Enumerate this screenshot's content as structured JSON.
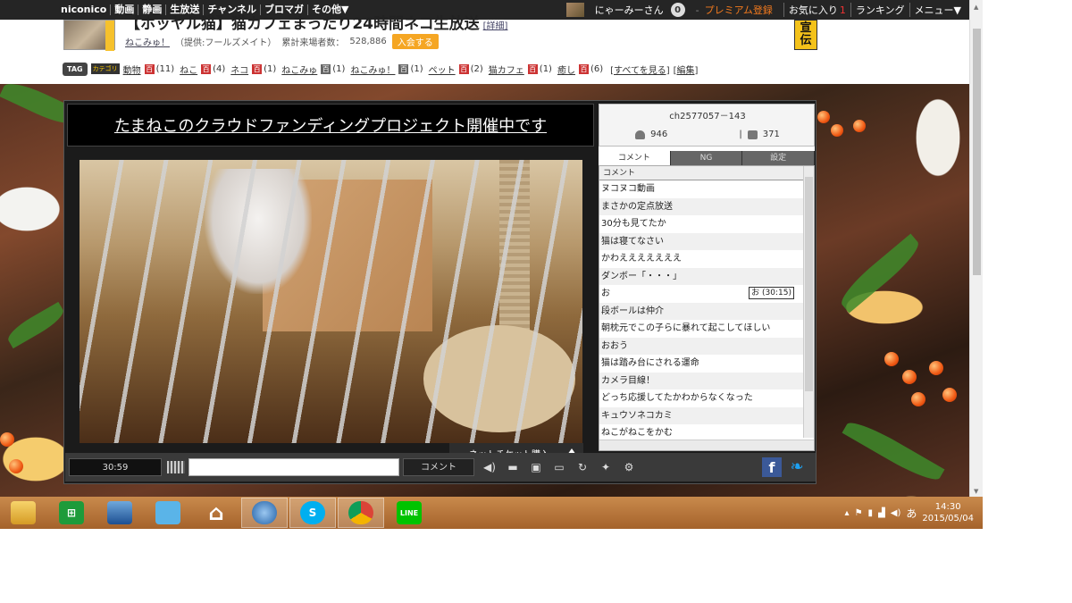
{
  "topnav": {
    "brand": "niconico",
    "links": [
      "動画",
      "静画",
      "生放送",
      "チャンネル",
      "ブロマガ",
      "その他▼"
    ],
    "user": "にゃーみーさん",
    "notif_count": "0",
    "premium": "プレミアム登録",
    "favorites": "お気に入り",
    "favorites_count": "1",
    "ranking": "ランキング",
    "menu": "メニュー▼"
  },
  "channel": {
    "title": "【ホッヤル猫】猫カフェまったり24時間ネコ生放送",
    "title_more": "[詳細]",
    "name": "ねこみゅ！",
    "provider": "（提供:フールズメイト）",
    "visitors_label": "累計来場者数：",
    "visitors": "528,886",
    "join_label": "入会する",
    "ad_label_1": "宣",
    "ad_label_2": "伝"
  },
  "tags": {
    "tag_icon": "TAG",
    "category_badge": "カテゴリ",
    "items": [
      {
        "name": "動物",
        "count": "(11)",
        "type": "red"
      },
      {
        "name": "ねこ",
        "count": "(4)",
        "type": "red"
      },
      {
        "name": "ネコ",
        "count": "(1)",
        "type": "red"
      },
      {
        "name": "ねこみゅ",
        "count": "(1)",
        "type": "gray"
      },
      {
        "name": "ねこみゅ！",
        "count": "(1)",
        "type": "gray"
      },
      {
        "name": "ペット",
        "count": "(2)",
        "type": "red"
      },
      {
        "name": "猫カフェ",
        "count": "(1)",
        "type": "red"
      },
      {
        "name": "癒し",
        "count": "(6)",
        "type": "red"
      }
    ],
    "dict_glyph": "百",
    "see_all": "[すべてを見る]",
    "edit": "[編集]"
  },
  "player": {
    "banner": "たまねこのクラウドファンディングプロジェクト開催中です",
    "ticket_label": "ネットチケット購入",
    "channel_id": "ch2577057－143",
    "viewers": "946",
    "comments_count": "371",
    "tabs": [
      "コメント",
      "NG",
      "設定"
    ],
    "comment_header": "コメント",
    "comments": [
      "ヌコヌコ動画",
      "まさかの定点放送",
      "30分も見てたか",
      "猫は寝てなさい",
      "かわえええええええ",
      "ダンボー「・・・」",
      "お",
      "段ボールは仲介",
      "朝枕元でこの子らに暴れて起こしてほしい",
      "おおう",
      "猫は踏み台にされる運命",
      "カメラ目線！",
      "どっち応援してたかわからなくなった",
      "キュウソネコカミ",
      "ねこがねこをかむ"
    ],
    "tooltip": "お (30:15)",
    "time": "30:59",
    "comment_button": "コメント",
    "comment_placeholder": ""
  },
  "taskbar": {
    "clock_time": "14:30",
    "clock_date": "2015/05/04",
    "ime": "あ",
    "apps": [
      "file-explorer-icon",
      "store-icon",
      "computer-icon",
      "mail-icon",
      "home-icon",
      "thunderbird-icon",
      "skype-icon",
      "chrome-icon",
      "line-icon"
    ],
    "app_labels": {
      "store": "⊞",
      "skype": "S",
      "line": "LINE"
    }
  },
  "colors": {
    "topnav_bg": "#252525",
    "premium": "#f37a1e",
    "join": "#f5a623",
    "taskbar": "#b8743a",
    "facebook": "#3b5998",
    "twitter": "#1da1f2"
  }
}
